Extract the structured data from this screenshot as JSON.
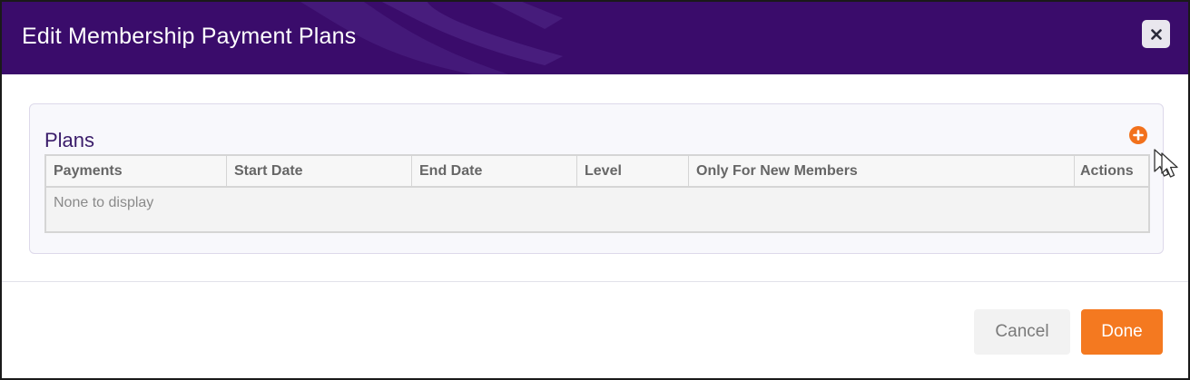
{
  "modal": {
    "title": "Edit Membership Payment Plans",
    "close_icon": "close-icon",
    "header_color": "#3a0c6b"
  },
  "plans": {
    "title": "Plans",
    "add_icon": "plus-circle-icon",
    "accent_color": "#f2711c",
    "columns": [
      "Payments",
      "Start Date",
      "End Date",
      "Level",
      "Only For New Members",
      "Actions"
    ],
    "rows": [],
    "empty_text": "None to display"
  },
  "footer": {
    "cancel_label": "Cancel",
    "done_label": "Done",
    "done_color": "#f47920"
  }
}
